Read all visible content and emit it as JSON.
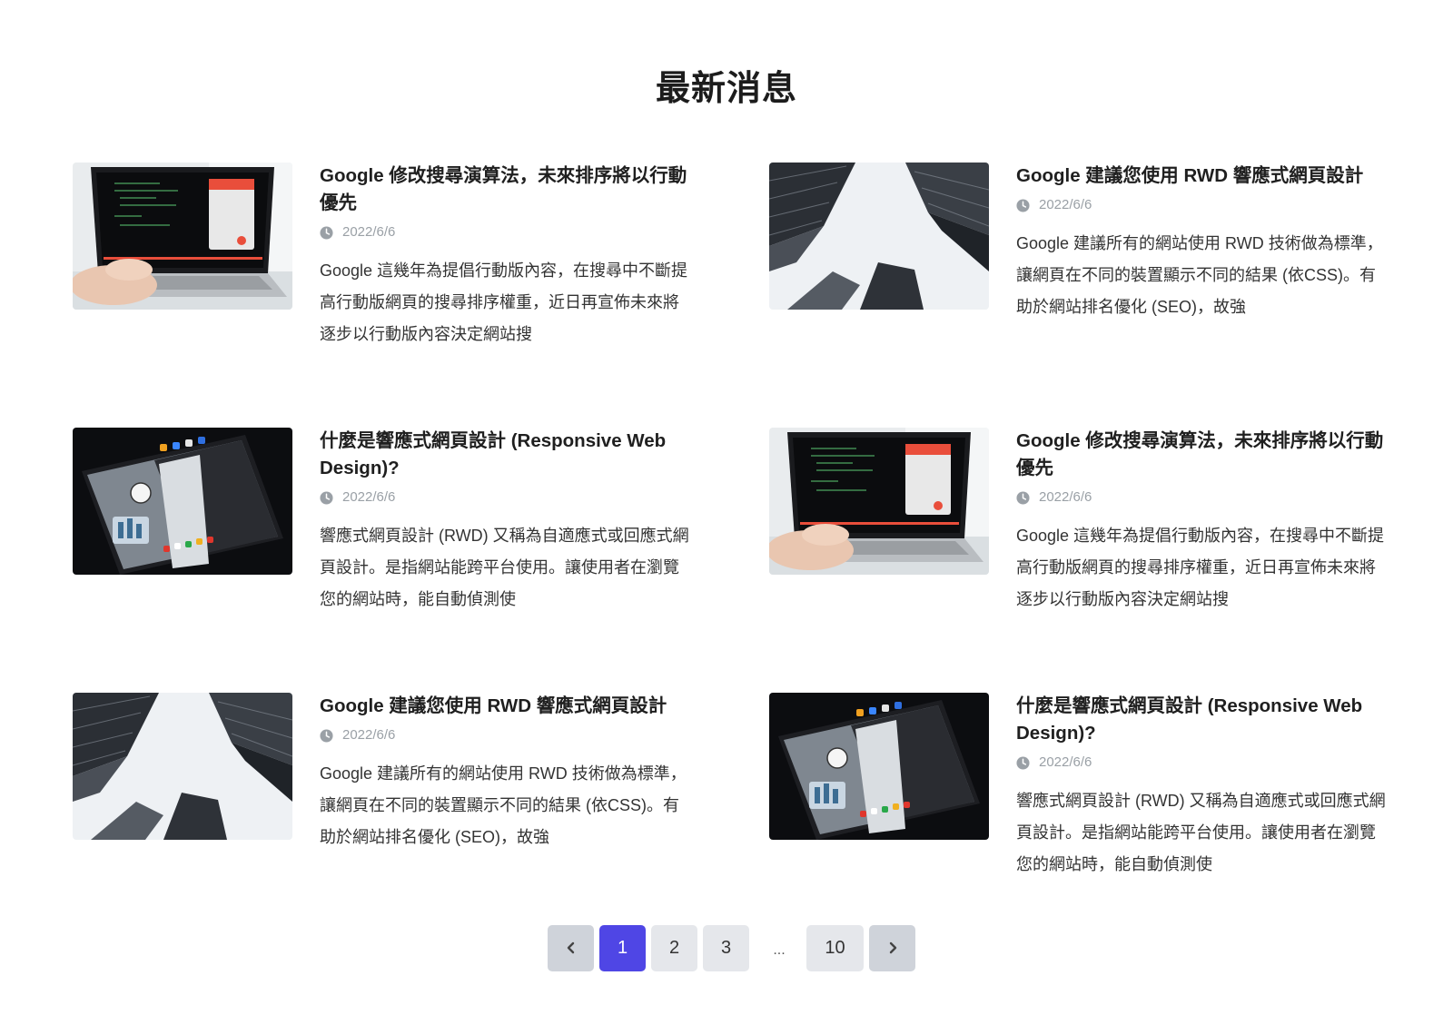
{
  "section": {
    "title": "最新消息"
  },
  "news": [
    {
      "title": "Google 修改搜尋演算法，未來排序將以行動優先",
      "date": "2022/6/6",
      "excerpt": "Google 這幾年為提倡行動版內容，在搜尋中不斷提高行動版網頁的搜尋排序權重，近日再宣佈未來將逐步以行動版內容決定網站搜",
      "image": "laptop-code"
    },
    {
      "title": "Google 建議您使用 RWD 響應式網頁設計",
      "date": "2022/6/6",
      "excerpt": "Google 建議所有的網站使用 RWD 技術做為標準，讓網頁在不同的裝置顯示不同的結果 (依CSS)。有助於網站排名優化 (SEO)，故強",
      "image": "skyscrapers"
    },
    {
      "title": "什麼是響應式網頁設計 (Responsive Web Design)?",
      "date": "2022/6/6",
      "excerpt": "響應式網頁設計 (RWD) 又稱為自適應式或回應式網頁設計。是指網站能跨平台使用。讓使用者在瀏覽您的網站時，能自動偵測使",
      "image": "tablet"
    },
    {
      "title": "Google 修改搜尋演算法，未來排序將以行動優先",
      "date": "2022/6/6",
      "excerpt": "Google 這幾年為提倡行動版內容，在搜尋中不斷提高行動版網頁的搜尋排序權重，近日再宣佈未來將逐步以行動版內容決定網站搜",
      "image": "laptop-code"
    },
    {
      "title": "Google 建議您使用 RWD 響應式網頁設計",
      "date": "2022/6/6",
      "excerpt": "Google 建議所有的網站使用 RWD 技術做為標準，讓網頁在不同的裝置顯示不同的結果 (依CSS)。有助於網站排名優化 (SEO)，故強",
      "image": "skyscrapers"
    },
    {
      "title": "什麼是響應式網頁設計 (Responsive Web Design)?",
      "date": "2022/6/6",
      "excerpt": "響應式網頁設計 (RWD) 又稱為自適應式或回應式網頁設計。是指網站能跨平台使用。讓使用者在瀏覽您的網站時，能自動偵測使",
      "image": "tablet"
    }
  ],
  "pagination": {
    "prev_icon": "chevron-left-icon",
    "next_icon": "chevron-right-icon",
    "pages": [
      "1",
      "2",
      "3"
    ],
    "ellipsis": "...",
    "last": "10",
    "current": "1"
  },
  "colors": {
    "accent": "#4f46e5",
    "page_bg": "#e5e7eb",
    "arrow_bg": "#cfd3da",
    "date": "#9aa0a6"
  }
}
